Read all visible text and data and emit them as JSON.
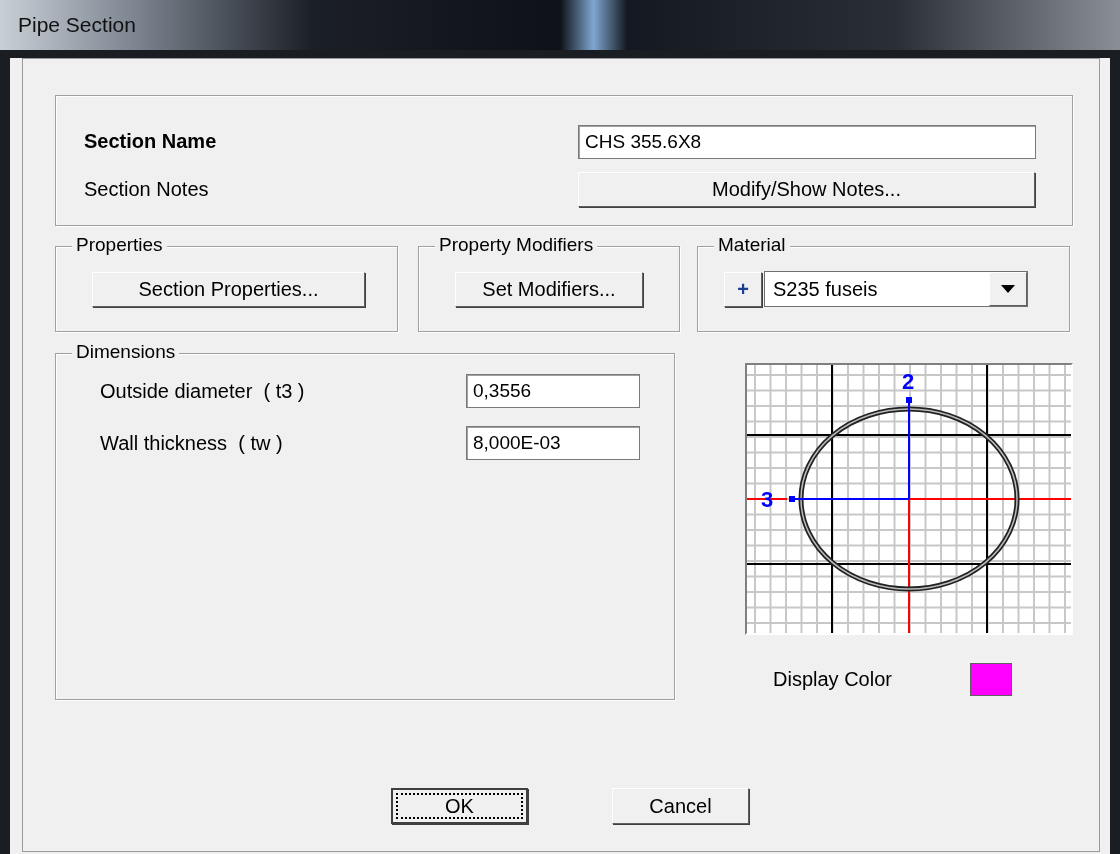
{
  "window": {
    "title": "Pipe Section"
  },
  "section_name": {
    "label": "Section Name",
    "value": "CHS 355.6X8"
  },
  "section_notes": {
    "label": "Section Notes",
    "button": "Modify/Show Notes..."
  },
  "properties": {
    "title": "Properties",
    "button": "Section Properties..."
  },
  "property_modifiers": {
    "title": "Property Modifiers",
    "button": "Set Modifiers..."
  },
  "material": {
    "title": "Material",
    "add_button": "+",
    "value": "S235 fuseis"
  },
  "dimensions": {
    "title": "Dimensions",
    "fields": [
      {
        "label": "Outside diameter  ( t3 )",
        "value": "0,3556"
      },
      {
        "label": "Wall thickness  ( tw )",
        "value": "8,000E-03"
      }
    ]
  },
  "preview": {
    "axis_labels": [
      "2",
      "3"
    ]
  },
  "display_color": {
    "label": "Display Color",
    "color": "#ff00ff"
  },
  "buttons": [
    {
      "label": "OK",
      "focused": true
    },
    {
      "label": "Cancel",
      "focused": false
    }
  ]
}
